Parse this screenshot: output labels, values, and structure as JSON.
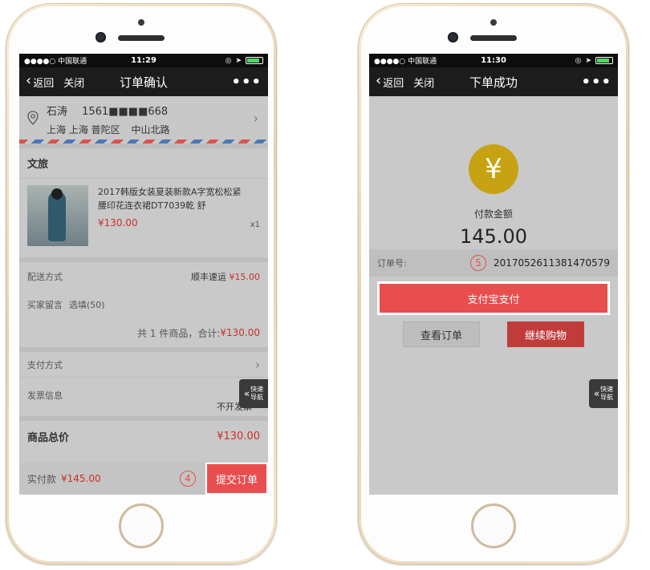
{
  "left": {
    "status": {
      "carrier": "●●●●○ 中国联通",
      "time": "11:29"
    },
    "nav": {
      "back": "返回",
      "close": "关闭",
      "title": "订单确认",
      "more": "•••"
    },
    "address": {
      "name": "石涛",
      "phone": "1561■■■■668",
      "location": "上海 上海 普陀区",
      "street": "中山北路"
    },
    "shop": "文旅",
    "product": {
      "title": "2017韩版女装夏装新款A字宽松松紧腰印花连衣裙DT7039乾 舒",
      "price": "¥130.00",
      "qty": "x1"
    },
    "shipping": {
      "label": "配送方式",
      "value": "顺丰速运",
      "price": "¥15.00"
    },
    "message": {
      "label": "买家留言",
      "placeholder": "选填(50)"
    },
    "total_line": {
      "text": "共 1 件商品，合计:",
      "amount": "¥130.00"
    },
    "payment": {
      "label": "支付方式"
    },
    "invoice": {
      "label": "发票信息",
      "value": "不开发票"
    },
    "summary": {
      "label": "商品总价",
      "amount": "¥130.00"
    },
    "bottom": {
      "label": "实付款",
      "amount": "¥145.00",
      "submit": "提交订单",
      "step": "4"
    },
    "quick_nav": {
      "line1": "快速",
      "line2": "导航"
    }
  },
  "right": {
    "status": {
      "carrier": "●●●●○ 中国联通",
      "time": "11:30"
    },
    "nav": {
      "back": "返回",
      "close": "关闭",
      "title": "下单成功",
      "more": "•••"
    },
    "yen": "¥",
    "pay_label": "付款金额",
    "pay_amount": "145.00",
    "order": {
      "label": "订单号:",
      "number": "2017052611381470579",
      "step": "5"
    },
    "alipay": "支付宝支付",
    "view_order": "查看订单",
    "continue": "继续购物",
    "quick_nav": {
      "line1": "快速",
      "line2": "导航"
    }
  },
  "colors": {
    "accent": "#e94e4e",
    "price": "#c9302c",
    "yen_circle": "#c7a212"
  }
}
